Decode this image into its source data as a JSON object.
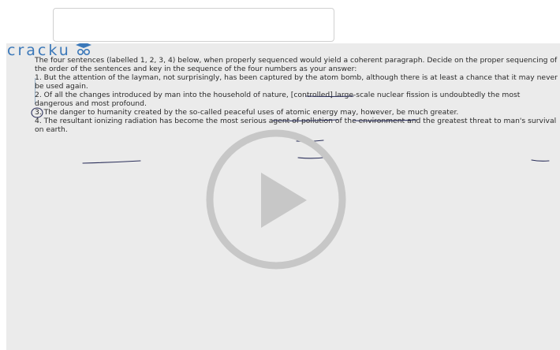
{
  "search": {
    "value": ""
  },
  "video": {
    "logo_text": "cracku",
    "lines": [
      "The four sentences (labelled 1, 2, 3, 4) below, when properly sequenced would yield a coherent paragraph. Decide on the proper sequencing of",
      "the order of the sentences and key in the sequence of the four numbers as your answer:",
      "1. But the attention of the layman, not surprisingly, has been captured by the atom bomb, although there is at least a chance that it may never",
      "be used again.",
      "2. Of all the changes introduced by man into the household of nature, [controlled] large-scale nuclear fission is undoubtedly the most",
      "dangerous and most profound.",
      "3. The danger to humanity created by the so-called peaceful uses of atomic energy may, however, be much greater.",
      "4. The resultant ionizing radiation has become the most serious agent of pollution of the environment and the greatest threat to man's survival",
      "on earth."
    ]
  }
}
